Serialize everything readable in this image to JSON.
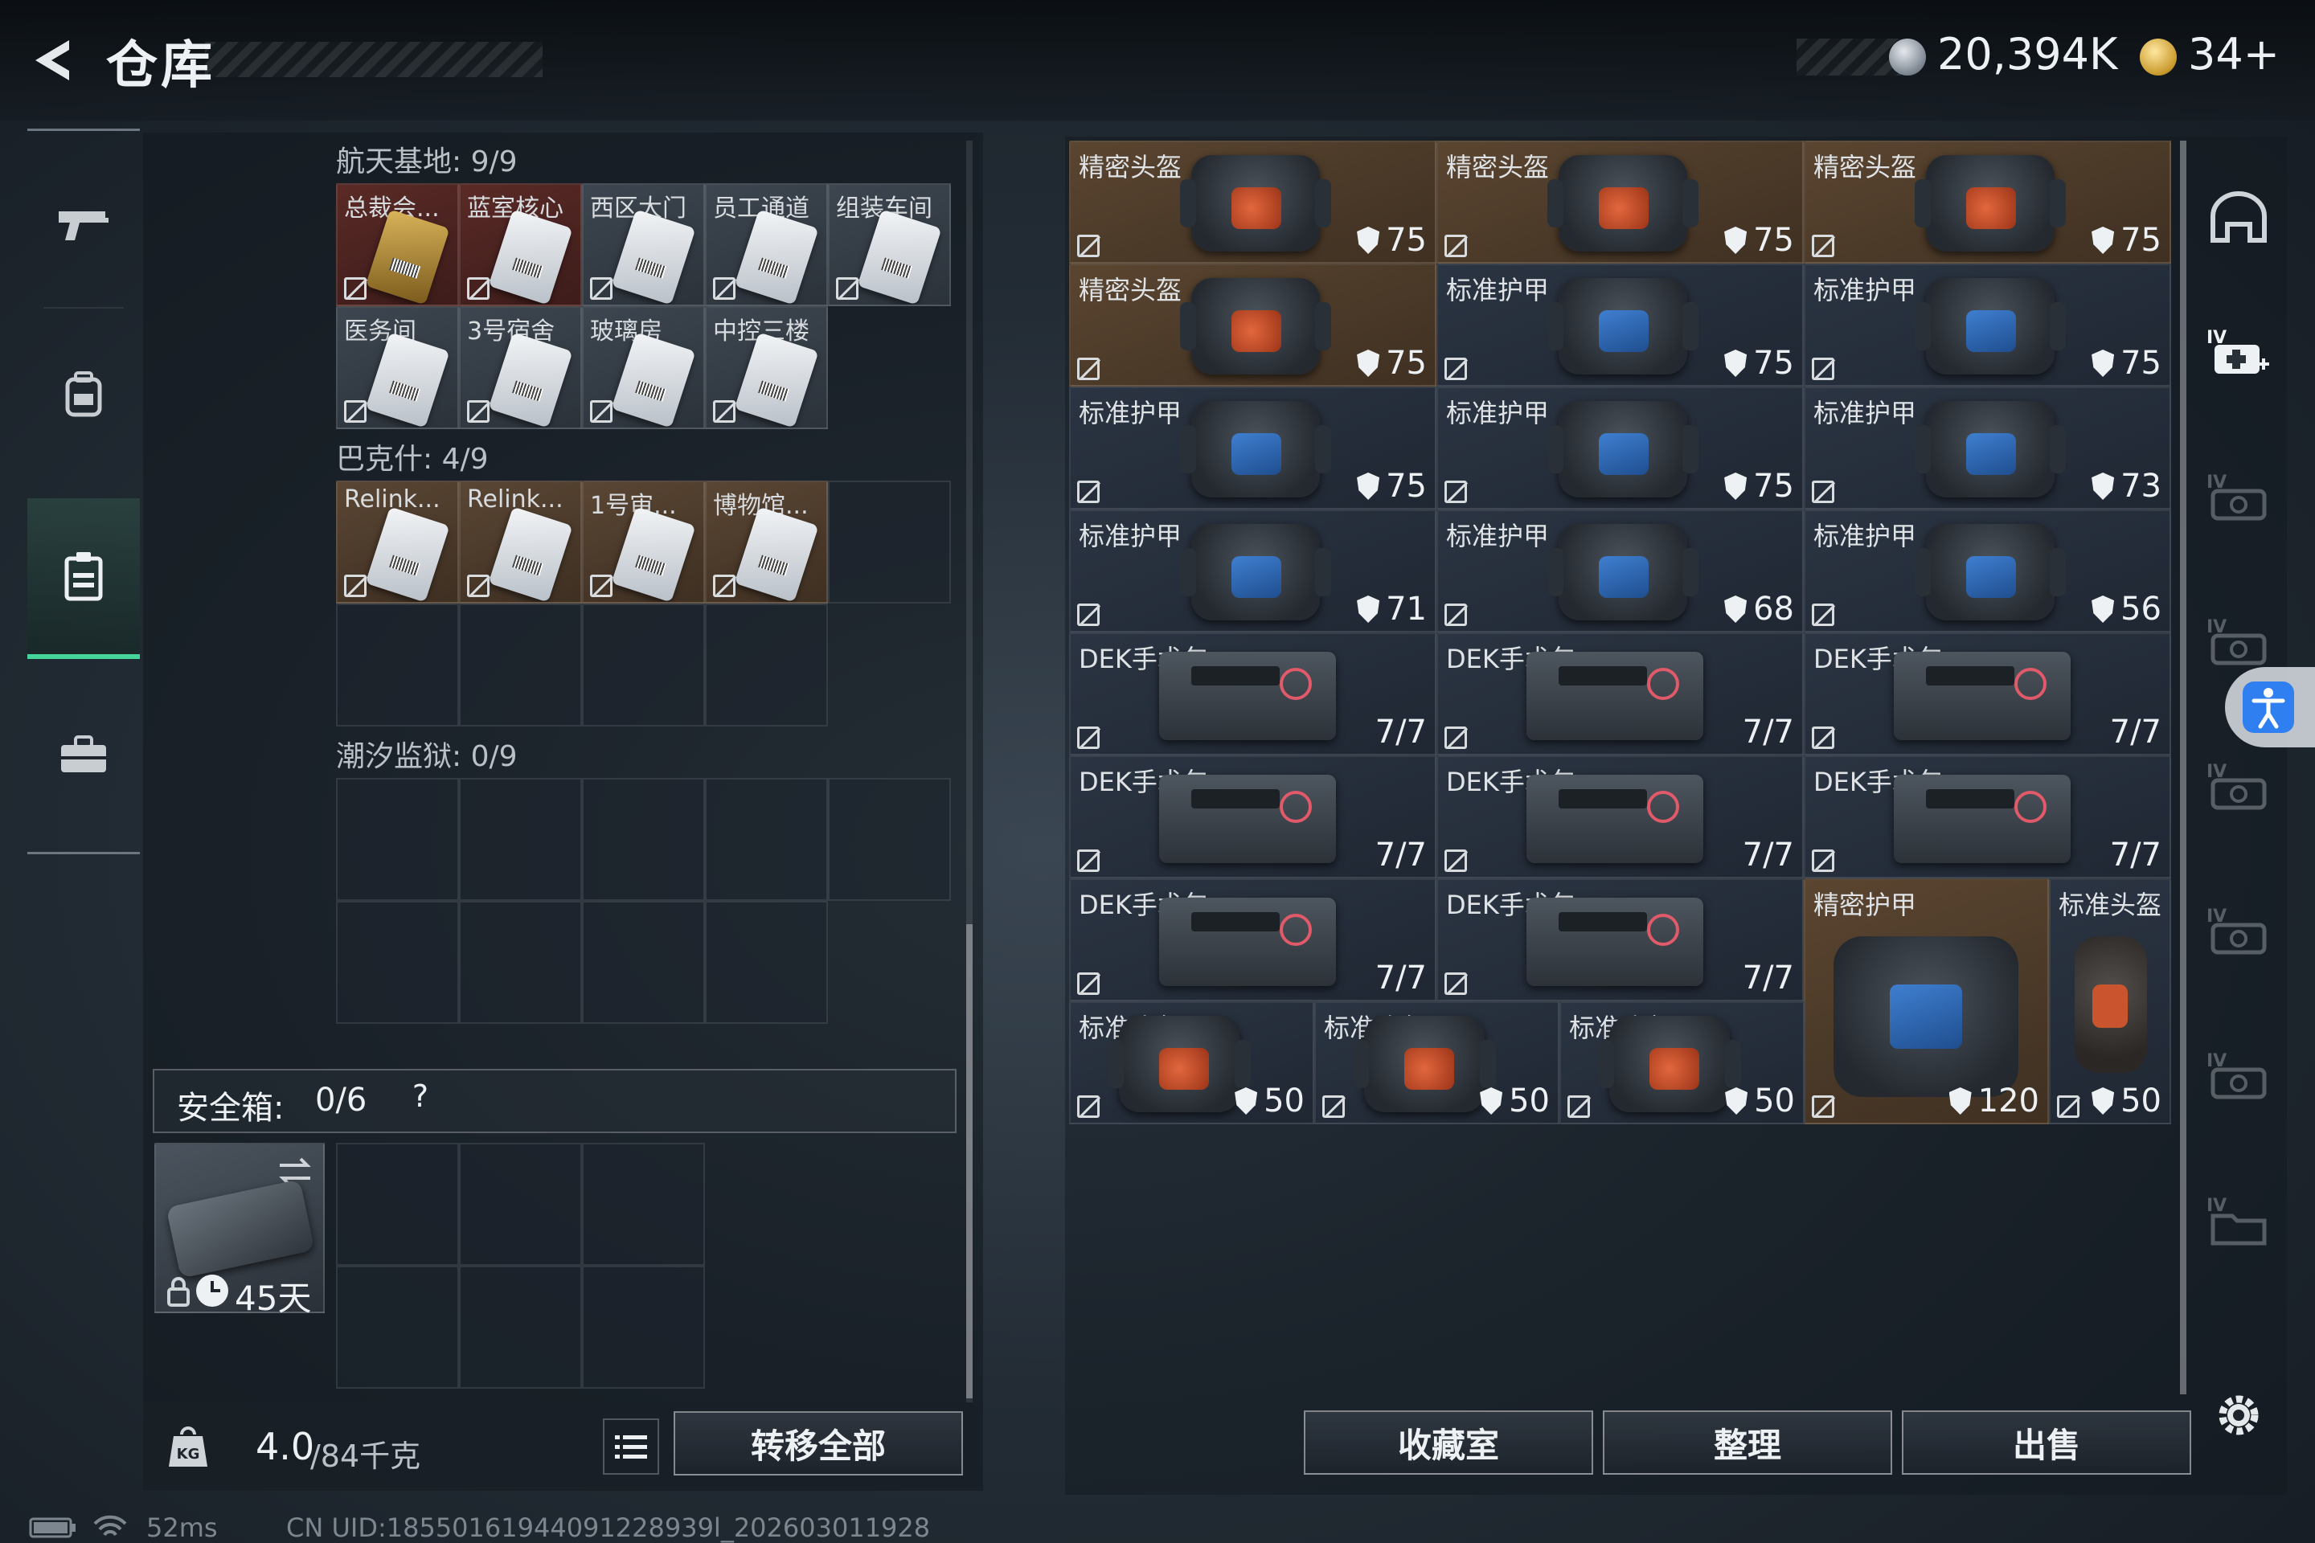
{
  "header": {
    "title": "仓库",
    "silver_amount": "20,394K",
    "gold_amount": "34+"
  },
  "left_nav": [
    {
      "name": "weapons",
      "icon": "gun-icon",
      "active": false
    },
    {
      "name": "gear",
      "icon": "backpack-icon",
      "active": false
    },
    {
      "name": "keys",
      "icon": "keycard-holder-icon",
      "active": true
    },
    {
      "name": "supplies",
      "icon": "briefcase-icon",
      "active": false
    }
  ],
  "sections": [
    {
      "label": "航天基地: 9/9",
      "cards": [
        {
          "name": "总裁会...",
          "color": "red",
          "img": "gold"
        },
        {
          "name": "蓝室核心",
          "color": "red",
          "img": "white"
        },
        {
          "name": "西区大门",
          "color": "grey",
          "img": "white"
        },
        {
          "name": "员工通道",
          "color": "grey",
          "img": "white"
        },
        {
          "name": "组装车间",
          "color": "grey",
          "img": "white"
        },
        {
          "name": "医务间",
          "color": "grey",
          "img": "white"
        },
        {
          "name": "3号宿舍",
          "color": "grey",
          "img": "white"
        },
        {
          "name": "玻璃房",
          "color": "grey",
          "img": "white"
        },
        {
          "name": "中控三楼",
          "color": "grey",
          "img": "white"
        }
      ]
    },
    {
      "label": "巴克什: 4/9",
      "cards": [
        {
          "name": "Relink...",
          "color": "brown",
          "img": "white"
        },
        {
          "name": "Relink...",
          "color": "brown",
          "img": "white"
        },
        {
          "name": "1号审...",
          "color": "brown",
          "img": "white"
        },
        {
          "name": "博物馆...",
          "color": "brown",
          "img": "white"
        }
      ]
    },
    {
      "label": "潮汐监狱: 0/9",
      "cards": []
    }
  ],
  "safe_box": {
    "label": "安全箱:",
    "count": "0/6",
    "help": "?",
    "timer": "45天"
  },
  "weight": {
    "current": "4.0",
    "max": "/84千克"
  },
  "buttons": {
    "transfer_all": "转移全部",
    "collection": "收藏室",
    "organize": "整理",
    "sell": "出售"
  },
  "items": [
    {
      "name": "精密头盔",
      "value": "75",
      "kind": "helmet",
      "bg": "brown"
    },
    {
      "name": "精密头盔",
      "value": "75",
      "kind": "helmet",
      "bg": "brown"
    },
    {
      "name": "精密头盔",
      "value": "75",
      "kind": "helmet",
      "bg": "brown"
    },
    {
      "name": "精密头盔",
      "value": "75",
      "kind": "helmet",
      "bg": "brown"
    },
    {
      "name": "标准护甲",
      "value": "75",
      "kind": "armor",
      "bg": "navy"
    },
    {
      "name": "标准护甲",
      "value": "75",
      "kind": "armor",
      "bg": "navy"
    },
    {
      "name": "标准护甲",
      "value": "75",
      "kind": "armor",
      "bg": "navy"
    },
    {
      "name": "标准护甲",
      "value": "75",
      "kind": "armor",
      "bg": "navy"
    },
    {
      "name": "标准护甲",
      "value": "73",
      "kind": "armor",
      "bg": "navy"
    },
    {
      "name": "标准护甲",
      "value": "71",
      "kind": "armor",
      "bg": "navy"
    },
    {
      "name": "标准护甲",
      "value": "68",
      "kind": "armor",
      "bg": "navy"
    },
    {
      "name": "标准护甲",
      "value": "56",
      "kind": "armor",
      "bg": "navy"
    },
    {
      "name": "DEK手术包",
      "value": "7/7",
      "kind": "medkit",
      "bg": "navy"
    },
    {
      "name": "DEK手术包",
      "value": "7/7",
      "kind": "medkit",
      "bg": "navy"
    },
    {
      "name": "DEK手术包",
      "value": "7/7",
      "kind": "medkit",
      "bg": "navy"
    },
    {
      "name": "DEK手术包",
      "value": "7/7",
      "kind": "medkit",
      "bg": "navy"
    },
    {
      "name": "DEK手术包",
      "value": "7/7",
      "kind": "medkit",
      "bg": "navy"
    },
    {
      "name": "DEK手术包",
      "value": "7/7",
      "kind": "medkit",
      "bg": "navy"
    },
    {
      "name": "DEK手术包",
      "value": "7/7",
      "kind": "medkit",
      "bg": "navy"
    },
    {
      "name": "DEK手术包",
      "value": "7/7",
      "kind": "medkit",
      "bg": "navy"
    }
  ],
  "small_helmets": [
    {
      "name": "标准头盔",
      "value": "50"
    },
    {
      "name": "标准头盔",
      "value": "50"
    },
    {
      "name": "标准头盔",
      "value": "50"
    }
  ],
  "big_armor": {
    "name": "精密护甲",
    "value": "120"
  },
  "tall_helmet": {
    "name": "标准头盔",
    "value": "50"
  },
  "status_bar": {
    "ping": "52ms",
    "uid": "CN UID:18550161944091228939l_202603011928"
  }
}
